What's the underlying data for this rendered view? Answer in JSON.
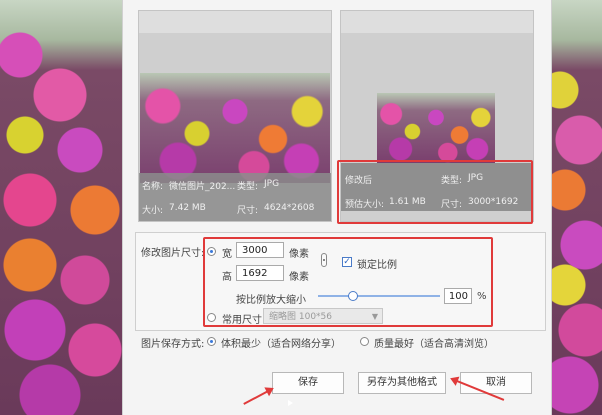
{
  "original": {
    "name_label": "名称:",
    "name_value": "微信图片_202...",
    "type_label": "类型:",
    "type_value": "JPG",
    "size_label": "大小:",
    "size_value": "7.42 MB",
    "dims_label": "尺寸:",
    "dims_value": "4624*2608"
  },
  "modified": {
    "title": "修改后",
    "type_label": "类型:",
    "type_value": "JPG",
    "est_size_label": "预估大小:",
    "est_size_value": "1.61 MB",
    "dims_label": "尺寸:",
    "dims_value": "3000*1692"
  },
  "resize": {
    "section_label": "修改图片尺寸:",
    "width_label": "宽",
    "width_value": "3000",
    "height_label": "高",
    "height_value": "1692",
    "unit_px": "像素",
    "lock_ratio_label": "锁定比例",
    "lock_ratio_checked": true,
    "scale_label": "按比例放大缩小",
    "scale_value": "100",
    "scale_unit": "%",
    "scale_fraction": 0.29,
    "common_size_label": "常用尺寸",
    "common_size_selected": "缩略图 100*56"
  },
  "save_mode": {
    "label": "图片保存方式:",
    "option_small": "体积最少（适合网络分享）",
    "option_quality": "质量最好（适合高清浏览）"
  },
  "buttons": {
    "save": "保存",
    "save_as": "另存为其他格式",
    "cancel": "取消"
  },
  "colors": {
    "highlight": "#e03a3a",
    "accent": "#3a78d8"
  }
}
